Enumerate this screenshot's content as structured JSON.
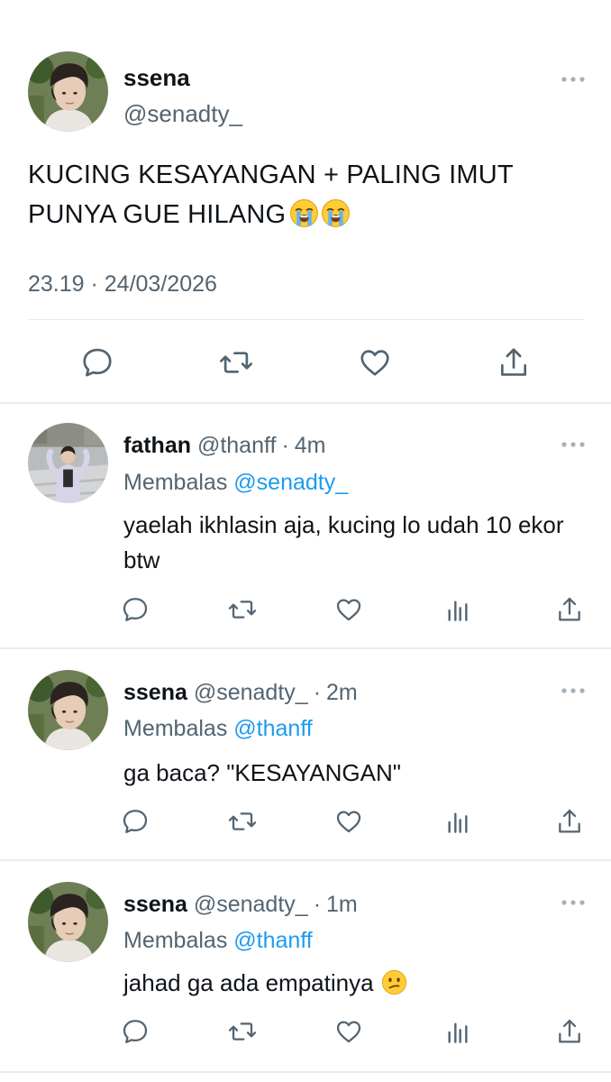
{
  "main_tweet": {
    "author_name": "ssena",
    "author_handle": "@senadty_",
    "text": "KUCING KESAYANGAN + PALING IMUT PUNYA GUE HILANG",
    "emojis": [
      "loudly-crying-face",
      "loudly-crying-face"
    ],
    "timestamp": "23.19 · 24/03/2026",
    "actions": [
      "reply",
      "retweet",
      "like",
      "share"
    ]
  },
  "replies": [
    {
      "author_name": "fathan",
      "author_handle": "@thanff",
      "dot": "·",
      "time": "4m",
      "reply_prefix": "Membalas",
      "reply_to": "@senadty_",
      "text": "yaelah ikhlasin aja, kucing lo udah 10 ekor btw",
      "actions": [
        "reply",
        "retweet",
        "like",
        "views",
        "share"
      ]
    },
    {
      "author_name": "ssena",
      "author_handle": "@senadty_",
      "dot": "·",
      "time": "2m",
      "reply_prefix": "Membalas",
      "reply_to": "@thanff",
      "text": "ga baca? \"KESAYANGAN\"",
      "actions": [
        "reply",
        "retweet",
        "like",
        "views",
        "share"
      ]
    },
    {
      "author_name": "ssena",
      "author_handle": "@senadty_",
      "dot": "·",
      "time": "1m",
      "reply_prefix": "Membalas",
      "reply_to": "@thanff",
      "text": "jahad ga ada empatinya",
      "emojis": [
        "confused-face"
      ],
      "actions": [
        "reply",
        "retweet",
        "like",
        "views",
        "share"
      ]
    }
  ],
  "colors": {
    "text": "#0f1419",
    "secondary": "#536471",
    "link": "#1d9bf0",
    "divider": "#e7ecef"
  }
}
